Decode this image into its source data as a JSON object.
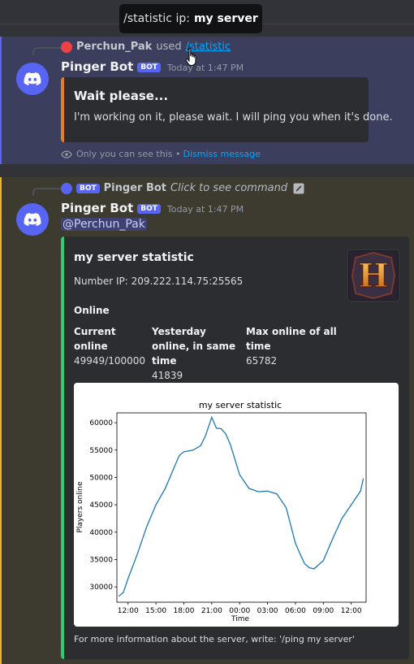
{
  "tooltip": {
    "label": "/statistic ip:",
    "value": "my server"
  },
  "message1": {
    "reply_user": "Perchun_Pak",
    "reply_used": "used",
    "reply_command": "/statistic",
    "author": "Pinger Bot",
    "bot_tag": "BOT",
    "timestamp": "Today at 1:47 PM",
    "embed_title": "Wait please...",
    "embed_text": "I'm working on it, please wait. I will ping you when it's done.",
    "ephemeral_text": "Only you can see this •",
    "dismiss_label": "Dismiss message"
  },
  "message2": {
    "reply_bot_tag": "BOT",
    "reply_user": "Pinger Bot",
    "reply_text": "Click to see command",
    "author": "Pinger Bot",
    "bot_tag": "BOT",
    "timestamp": "Today at 1:47 PM",
    "mention": "@Perchun_Pak",
    "embed": {
      "title": "my server statistic",
      "description": "Number IP: 209.222.114.75:25565",
      "online_heading": "Online",
      "fields": [
        {
          "name": "Current online",
          "value": "49949/100000"
        },
        {
          "name": "Yesterday online, in same time",
          "value": "41839"
        },
        {
          "name": "Max online of all time",
          "value": "65782"
        }
      ],
      "thumbnail_letter": "H",
      "footer": "For more information about the server, write: '/ping my server'"
    }
  },
  "colors": {
    "accent_blurple": "#5865f2",
    "embed_orange": "#e67e22",
    "embed_green": "#2ecc71",
    "link_blue": "#00a8fc",
    "mention_bg": "#3e4270",
    "line_blue": "#1f77b4"
  },
  "chart_data": {
    "type": "line",
    "title": "my server statistic",
    "xlabel": "Time",
    "ylabel": "Players online",
    "x_ticks": [
      "12:00",
      "15:00",
      "18:00",
      "21:00",
      "00:00",
      "03:00",
      "06:00",
      "09:00",
      "12:00"
    ],
    "y_ticks": [
      30000,
      35000,
      40000,
      45000,
      50000,
      55000,
      60000
    ],
    "xlim": [
      10.8,
      37.6
    ],
    "ylim": [
      27200,
      61800
    ],
    "grid": false,
    "series": [
      {
        "x": [
          11,
          11.5,
          12,
          13,
          14,
          15,
          16,
          17,
          17.5,
          18,
          19,
          19.8,
          20.3,
          20.8,
          21,
          21.5,
          22,
          22.5,
          23,
          24,
          25,
          26,
          27,
          28,
          29,
          30,
          30.5,
          31,
          31.5,
          32,
          33,
          34,
          35,
          36,
          37,
          37.3
        ],
        "y": [
          28300,
          29000,
          31500,
          36000,
          41000,
          45000,
          48000,
          52000,
          54000,
          54700,
          55000,
          55800,
          57500,
          60000,
          61000,
          59000,
          58900,
          58000,
          56000,
          50500,
          48000,
          47400,
          47500,
          47000,
          44500,
          38000,
          36000,
          34200,
          33500,
          33300,
          34800,
          38800,
          42500,
          45000,
          47500,
          49800
        ]
      }
    ]
  }
}
